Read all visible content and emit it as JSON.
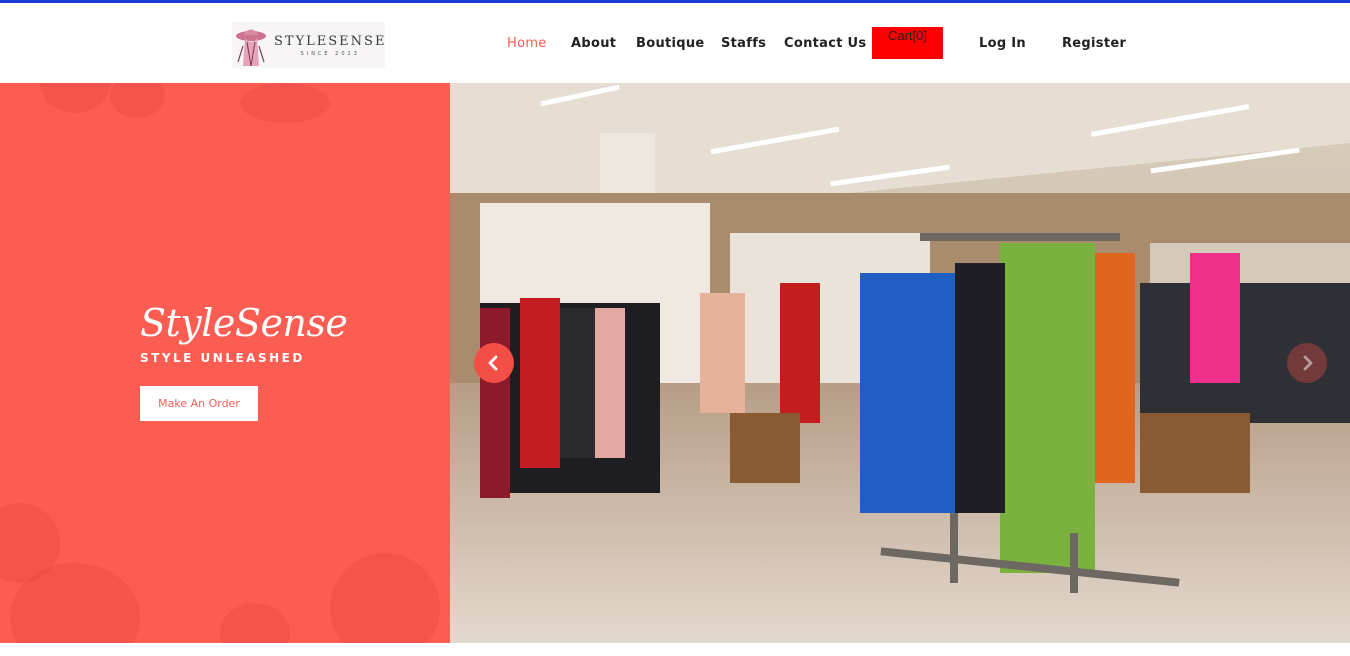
{
  "logo": {
    "title": "STYLESENSE",
    "subtitle": "SINCE 2023"
  },
  "nav": {
    "home": "Home",
    "about": "About",
    "boutique": "Boutique",
    "staffs": "Staffs",
    "contact": "Contact Us",
    "cart": "Cart[0]",
    "login": "Log In",
    "register": "Register"
  },
  "hero": {
    "brand": "StyleSense",
    "tagline": "STYLE UNLEASHED",
    "cta": "Make An Order"
  },
  "colors": {
    "accent": "#f75d52",
    "hero_bg": "#fc5d53",
    "cart_bg": "#ff0000",
    "top_line": "#1a3fd1"
  },
  "icons": {
    "prev": "chevron-left-icon",
    "next": "chevron-right-icon"
  }
}
